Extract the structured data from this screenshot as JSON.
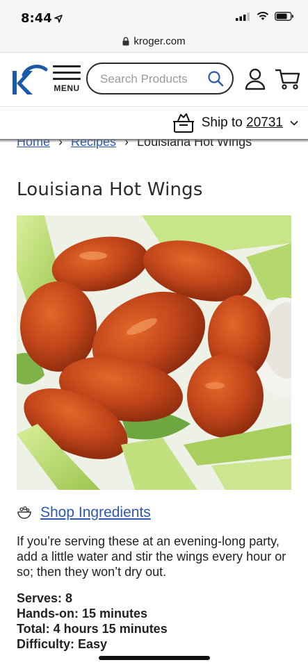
{
  "status": {
    "time": "8:44"
  },
  "browser": {
    "url": "kroger.com"
  },
  "header": {
    "menu_label": "MENU",
    "search_placeholder": "Search Products"
  },
  "ship": {
    "label": "Ship to",
    "zip": "20731"
  },
  "breadcrumbs": [
    {
      "label": "Home"
    },
    {
      "label": "Recipes"
    },
    {
      "label": "Louisiana Hot Wings"
    }
  ],
  "recipe": {
    "title": "Louisiana Hot Wings",
    "shop_label": "Shop Ingredients",
    "description": "If you’re serving these at an evening-long party, add a little water and stir the wings every hour or so; then they won’t dry out.",
    "facts": [
      "Serves: 8",
      "Hands-on: 15 minutes",
      "Total: 4 hours 15 minutes",
      "Difficulty: Easy"
    ]
  },
  "colors": {
    "link": "#2b59b1",
    "brand": "#1b5aa6"
  }
}
